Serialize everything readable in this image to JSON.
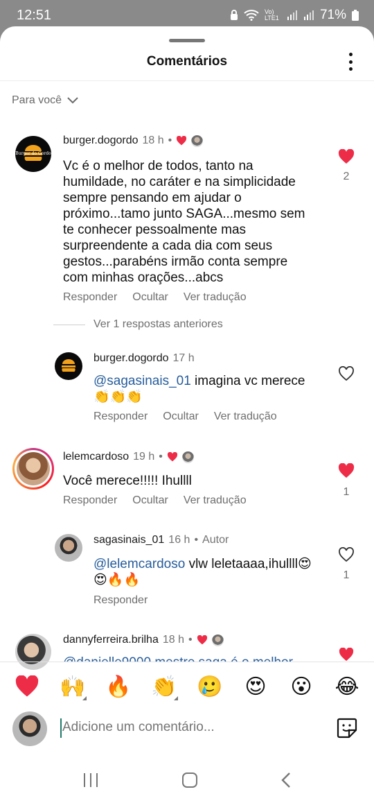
{
  "status_bar": {
    "time": "12:51",
    "network": "Vo) LTE1",
    "battery": "71%"
  },
  "header": {
    "title": "Comentários"
  },
  "filter": {
    "label": "Para você"
  },
  "comments": [
    {
      "username": "burger.dogordo",
      "time": "18 h",
      "text": "Vc é o melhor de todos, tanto na humildade, no caráter e na simplicidade sempre pensando em ajudar o próximo...tamo junto SAGA...mesmo sem te conhecer pessoalmente mas surpreendente a cada dia com seus gestos...parabéns irmão conta sempre com minhas orações...abcs",
      "lines": [
        "Vc é o melhor de todos, tanto na",
        "humildade, no caráter e na simplicidade",
        "sempre pensando em ajudar o",
        "próximo...tamo junto SAGA...mesmo sem",
        "te conhecer pessoalmente mas",
        "surpreendente a cada dia com seus",
        "gestos...parabéns irmão conta sempre",
        "com minhas orações...abcs"
      ],
      "actions": [
        "Responder",
        "Ocultar",
        "Ver tradução"
      ],
      "likes": "2",
      "avatar_text": "Burger do Gordo"
    },
    {
      "username": "burger.dogordo",
      "time": "17 h",
      "mention": "@sagasinais_01",
      "text": " imagina vc merece",
      "emoji_line": "👏👏👏",
      "actions": [
        "Responder",
        "Ocultar",
        "Ver tradução"
      ],
      "avatar_text": "Burger do Gordo"
    },
    {
      "username": "lelemcardoso",
      "time": "19 h",
      "text": "Você merece!!!!! Ihullll",
      "actions": [
        "Responder",
        "Ocultar",
        "Ver tradução"
      ],
      "likes": "1"
    },
    {
      "username": "sagasinais_01",
      "time": "16 h",
      "author_tag": "Autor",
      "mention": "@lelemcardoso",
      "text": " vlw leletaaaa,ihullll😍",
      "emoji_line": "😍🔥🔥",
      "actions": [
        "Responder"
      ],
      "likes": "1"
    },
    {
      "username": "dannyferreira.brilha",
      "time": "18 h",
      "text": "@danielle9000 mestre saga é o melhor"
    }
  ],
  "replies_link": "Ver 1 respostas anteriores",
  "reactions": [
    "❤️",
    "🙌",
    "🔥",
    "👏",
    "🥲",
    "😍",
    "😮",
    "😂"
  ],
  "composer": {
    "placeholder": "Adicione um comentário..."
  },
  "colors": {
    "like_red": "#ed2d48",
    "mention_blue": "#275d9c",
    "muted": "#6e6e6e"
  }
}
